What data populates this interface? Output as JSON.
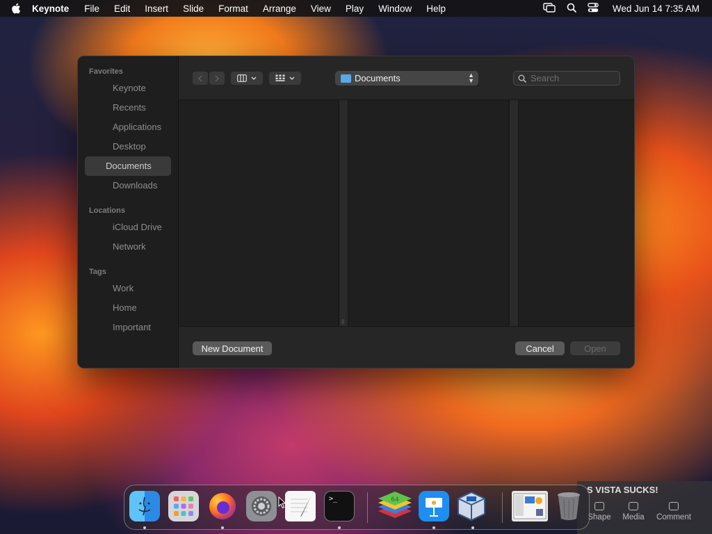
{
  "menubar": {
    "app_name": "Keynote",
    "menus": [
      "File",
      "Edit",
      "Insert",
      "Slide",
      "Format",
      "Arrange",
      "View",
      "Play",
      "Window",
      "Help"
    ],
    "clock": "Wed Jun 14  7:35 AM"
  },
  "dialog": {
    "sidebar": {
      "favorites_heading": "Favorites",
      "favorites": [
        "Keynote",
        "Recents",
        "Applications",
        "Desktop",
        "Documents",
        "Downloads"
      ],
      "selected": "Documents",
      "locations_heading": "Locations",
      "locations": [
        "iCloud Drive",
        "Network"
      ],
      "tags_heading": "Tags",
      "tags": [
        "Work",
        "Home",
        "Important"
      ]
    },
    "toolbar": {
      "current_folder": "Documents",
      "search_placeholder": "Search"
    },
    "footer": {
      "new_document_label": "New Document",
      "cancel_label": "Cancel",
      "open_label": "Open"
    }
  },
  "keynote_strip": {
    "title": "S VISTA SUCKS!",
    "tools": [
      "Shape",
      "Media",
      "Comment"
    ]
  },
  "colors": {
    "dialog_bg": "#242424",
    "sidebar_bg": "#1e1e1e",
    "folder_blue": "#5aa9e6"
  }
}
